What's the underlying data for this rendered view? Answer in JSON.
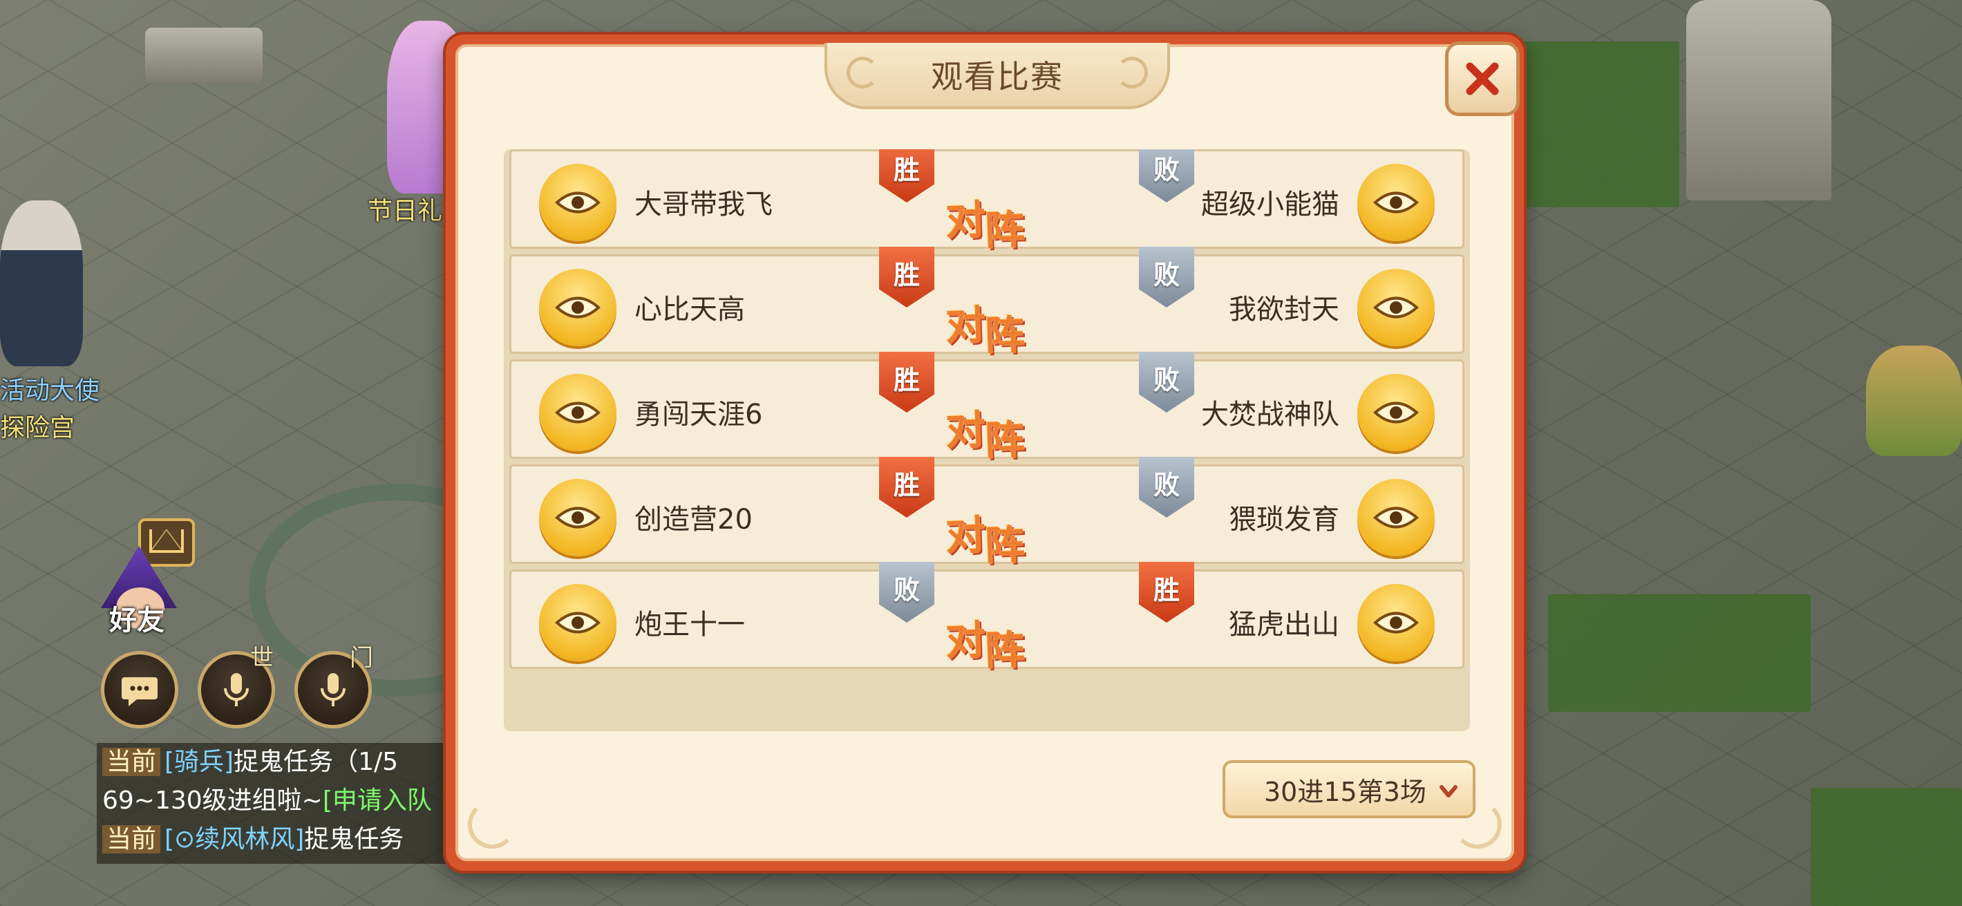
{
  "scene": {
    "npc_labels": [
      "节日礼",
      "活动大使",
      "探险宫"
    ],
    "friends_label": "好友",
    "voice_world_tag": "世",
    "voice_guild_tag": "门"
  },
  "chat": {
    "lines": [
      {
        "channel": "当前",
        "name": "[骑兵]",
        "text": "捉鬼任务（1/5"
      },
      {
        "channel": "",
        "name": "",
        "text": "69~130级进组啦~",
        "extra": "[申请入队"
      },
      {
        "channel": "当前",
        "name": "[⊙续风林风]",
        "text": "捉鬼任务"
      },
      {
        "channel": "",
        "name": "",
        "text": "~130级进组啦~",
        "extra": "[申请入队"
      }
    ]
  },
  "modal": {
    "title": "观看比赛",
    "close_icon": "close-icon",
    "vs_text_1": "对",
    "vs_text_2": "阵",
    "matches": [
      {
        "left": "大哥带我飞",
        "right": "超级小能猫",
        "left_result": "胜",
        "right_result": "败"
      },
      {
        "left": "心比天高",
        "right": "我欲封天",
        "left_result": "胜",
        "right_result": "败"
      },
      {
        "left": "勇闯天涯6",
        "right": "大焚战神队",
        "left_result": "胜",
        "right_result": "败"
      },
      {
        "left": "创造营20",
        "right": "猥琐发育",
        "left_result": "胜",
        "right_result": "败"
      },
      {
        "left": "炮王十一",
        "right": "猛虎出山",
        "left_result": "败",
        "right_result": "胜"
      }
    ],
    "round_selector": "30进15第3场"
  },
  "colors": {
    "win": "#d9471f",
    "lose": "#8f9caa",
    "frame": "#d7552d",
    "eye_button": "#f3b824"
  }
}
